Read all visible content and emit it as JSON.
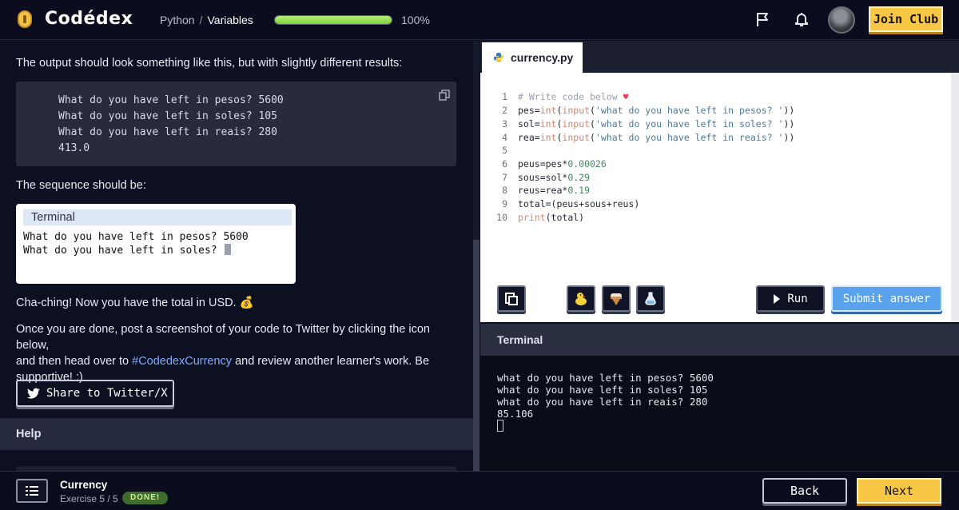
{
  "header": {
    "logo_text": "Codédex",
    "breadcrumb_course": "Python",
    "breadcrumb_separator": "/",
    "breadcrumb_current": "Variables",
    "progress_percent": 100,
    "progress_label": "100%",
    "join_label": "Join Club",
    "icons": [
      "coin-logo-icon",
      "flag-icon",
      "bell-icon"
    ]
  },
  "lesson": {
    "intro_text": "The output should look something like this, but with slightly different results:",
    "sample_output": [
      "What do you have left in pesos? 5600",
      "What do you have left in soles? 105",
      "What do you have left in reais? 280",
      "413.0"
    ],
    "sequence_text": "The sequence should be:",
    "terminal_title": "Terminal",
    "terminal_lines": [
      "What do you have left in pesos? 5600",
      "What do you have left in soles? "
    ],
    "cha_ching_text": "Cha-ching! Now you have the total in USD. 💰",
    "share_para_1": "Once you are done, post a screenshot of your code to Twitter by clicking the icon below,",
    "share_para_2a": "and then head over to ",
    "share_para_link": "#CodedexCurrency",
    "share_para_2b": " and review another learner's work. Be",
    "share_para_3": "supportive! :)",
    "share_button": "Share to Twitter/X",
    "help_label": "Help"
  },
  "editor": {
    "filename": "currency.py",
    "line_numbers": [
      "1",
      "2",
      "3",
      "4",
      "5",
      "6",
      "7",
      "8",
      "9",
      "10"
    ],
    "comment": "# Write code below ",
    "run_label": "Run",
    "submit_label": "Submit answer"
  },
  "output": {
    "header": "Terminal",
    "lines": [
      "what do you have left in pesos? 5600",
      "what do you have left in soles? 105",
      "what do you have left in reais? 280",
      "85.106"
    ]
  },
  "footer": {
    "exercise_title": "Currency",
    "exercise_sub": "Exercise 5 / 5",
    "done_badge": "DONE!",
    "back_label": "Back",
    "next_label": "Next"
  },
  "colors": {
    "accent_yellow": "#f7c745",
    "submit_blue": "#5aa3ec",
    "progress_green": "#7fd13b",
    "background": "#0d1020"
  }
}
